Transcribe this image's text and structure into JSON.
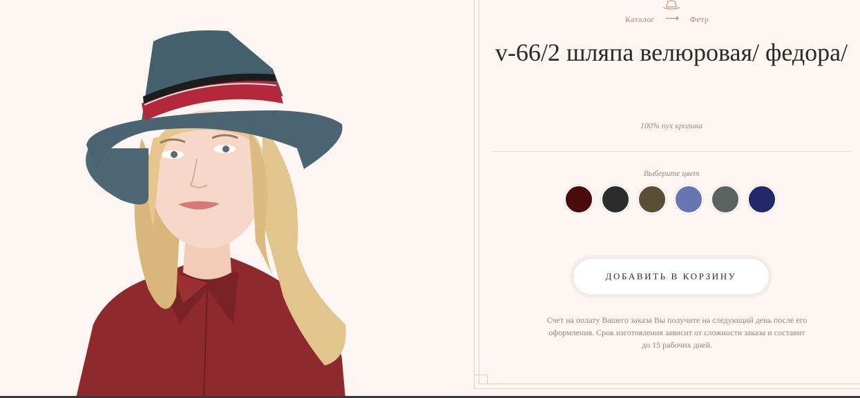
{
  "breadcrumb": {
    "catalog": "Каталог",
    "arrow": "⟶",
    "category": "Фетр"
  },
  "product": {
    "title": "v-66/2 шляпа велюровая/ федора/",
    "material": "100% пух кролика"
  },
  "colors": {
    "label": "Выберите цвет",
    "swatches": [
      "#4a0b0b",
      "#2c2c2c",
      "#5b4e37",
      "#6776b2",
      "#5c6260",
      "#21296a"
    ]
  },
  "cart_button": {
    "label": "ДОБАВИТЬ В КОРЗИНУ"
  },
  "note": "Счет на оплату Вашего заказа Вы получите на следующий день после его оформления. Срок изготовления зависит от сложности заказа и составит до 15 рабочих дней.",
  "icons": {
    "logo": "hat-icon"
  }
}
